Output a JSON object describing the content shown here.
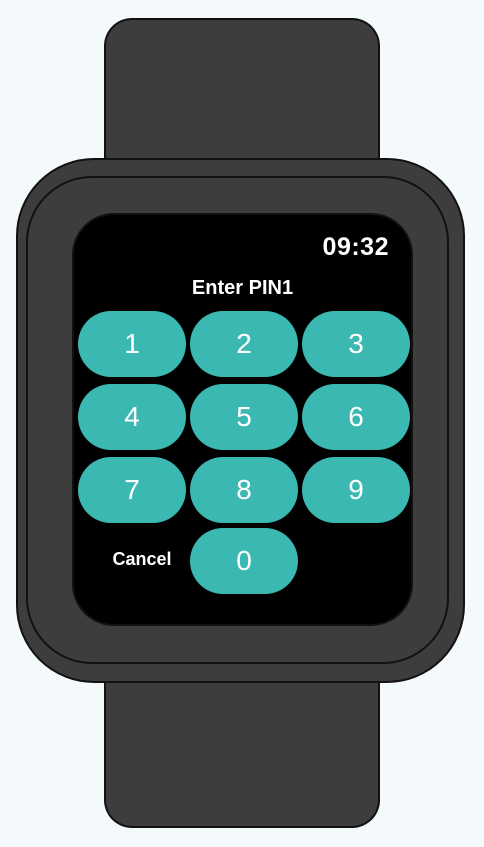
{
  "status_bar": {
    "time": "09:32"
  },
  "title": "Enter PIN1",
  "keypad": {
    "keys": [
      "1",
      "2",
      "3",
      "4",
      "5",
      "6",
      "7",
      "8",
      "9",
      "0"
    ],
    "cancel_label": "Cancel"
  },
  "colors": {
    "key_background": "#3bb8b2",
    "screen_background": "#000000",
    "watch_body": "#3d3d3d"
  }
}
